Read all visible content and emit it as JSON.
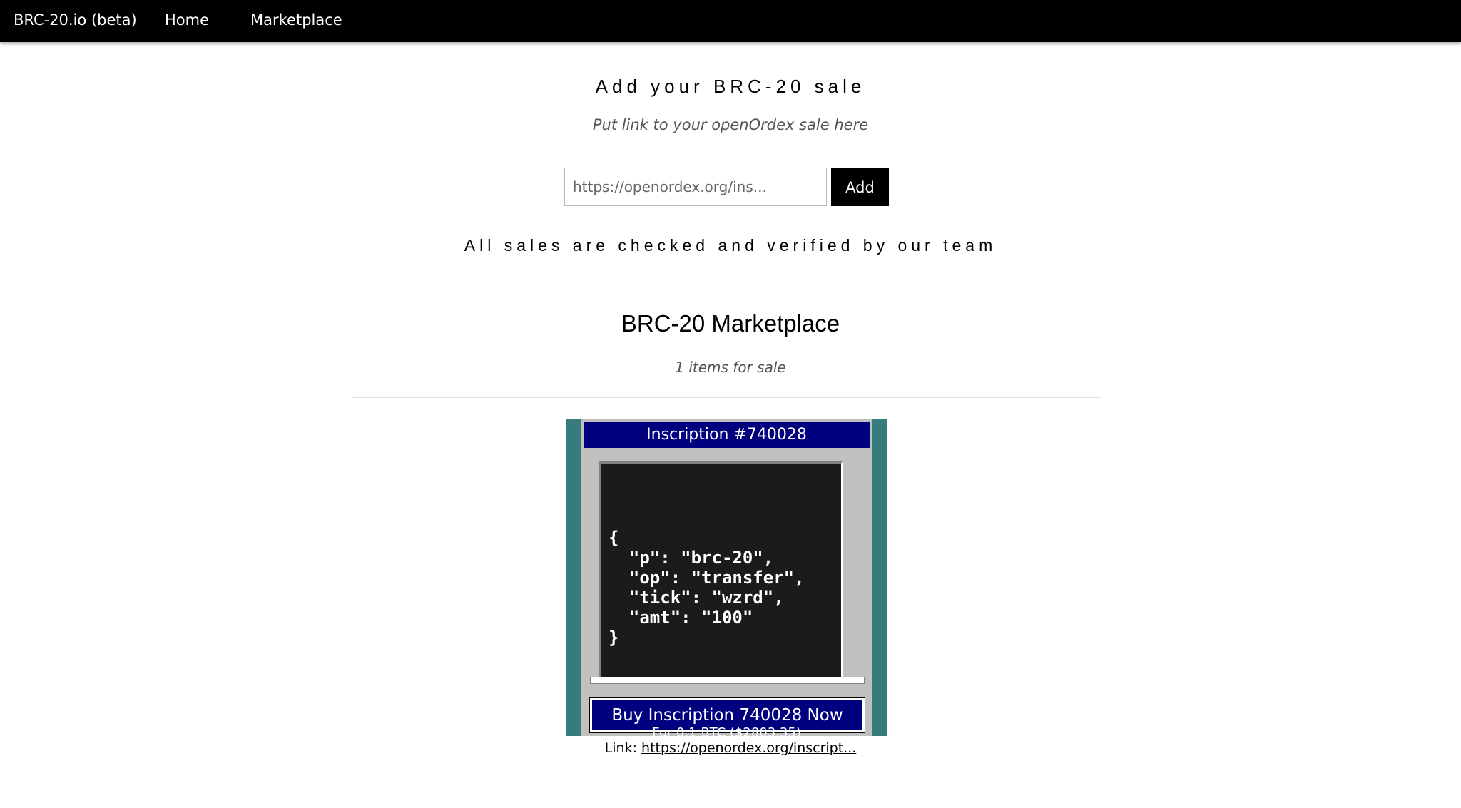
{
  "nav": {
    "brand": "BRC-20.io (beta)",
    "home": "Home",
    "marketplace": "Marketplace"
  },
  "add_sale": {
    "title": "Add your BRC-20 sale",
    "subtitle": "Put link to your openOrdex sale here",
    "input_placeholder": "https://openordex.org/ins...",
    "button_label": "Add",
    "verified_note": "All sales are checked and verified by our team"
  },
  "marketplace": {
    "title": "BRC-20 Marketplace",
    "items_count": "1 items for sale",
    "listing": {
      "window_title": "Inscription #740028",
      "code": "{\n  \"p\": \"brc-20\",\n  \"op\": \"transfer\",\n  \"tick\": \"wzrd\",\n  \"amt\": \"100\"\n}",
      "buy_label": "Buy Inscription 740028 Now",
      "price_text": "For 0.1 BTC ($2803.35)",
      "link_label": "Link: ",
      "link_text": "https://openordex.org/inscript..."
    }
  },
  "colors": {
    "nav_bg": "#000000",
    "card_bg": "#367c7b",
    "window_bg": "#c0c0c0",
    "title_bar": "#00007e",
    "code_bg": "#1a1b1c"
  }
}
